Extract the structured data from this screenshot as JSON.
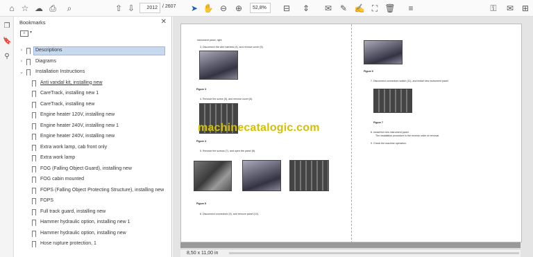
{
  "toolbar": {
    "page_current": "2012",
    "page_total": "2607",
    "zoom": "52,8%"
  },
  "sidebar": {
    "title": "Bookmarks",
    "items": [
      {
        "label": "Descriptions",
        "level": 0,
        "chevron": "right",
        "selected": true
      },
      {
        "label": "Diagrams",
        "level": 0,
        "chevron": "right"
      },
      {
        "label": "Installation Instructions",
        "level": 0,
        "chevron": "down"
      },
      {
        "label": "Anti vandal kit, installing new",
        "level": 1,
        "underline": true
      },
      {
        "label": "CareTrack, installing new 1",
        "level": 1
      },
      {
        "label": "CareTrack, installing new",
        "level": 1
      },
      {
        "label": "Engine heater 120V, installing new",
        "level": 1
      },
      {
        "label": "Engine heater 240V, installing new 1",
        "level": 1
      },
      {
        "label": "Engine heater 240V, installing new",
        "level": 1
      },
      {
        "label": "Extra work lamp, cab front only",
        "level": 1
      },
      {
        "label": "Extra work lamp",
        "level": 1
      },
      {
        "label": "FOG (Falling Object Guard), installing new",
        "level": 1
      },
      {
        "label": "FOG cabin mounted",
        "level": 1
      },
      {
        "label": "FOPS (Falling Object Protecting Structure), installing new",
        "level": 1
      },
      {
        "label": "FOPS",
        "level": 1
      },
      {
        "label": "Full track guard, installing new",
        "level": 1
      },
      {
        "label": "Hammer hydraulic option, installing new 1",
        "level": 1
      },
      {
        "label": "Hammer hydraulic option, installing new",
        "level": 1
      },
      {
        "label": "Hose rupture protection, 1",
        "level": 1
      }
    ]
  },
  "document": {
    "left": {
      "line0": "instrument panel, right",
      "step3": "3.   Disconnect the wire harness (4), and remove cover (5).",
      "fig3": "Figure 3",
      "step4": "4.   Remove the screw (5), and remove cover (6).",
      "fig4": "Figure 4",
      "step5": "5.   Remove the screws (7), and open the panel (8).",
      "fig5": "Figure 5",
      "step6": "6.   Disconnect connectors (9), and remove panel (10)."
    },
    "right": {
      "fig6": "Figure 6",
      "step7": "7.   Disconnect connectors switch (11), and install new instrument panel.",
      "fig7": "Figure 7",
      "step8": "8.   Install the new instrument panel.",
      "step8b": "The installation procedure is the reverse order of removal.",
      "step9": "9.   Check the machine operation."
    }
  },
  "watermark": "machinecatalogic.com",
  "status": {
    "page_size": "8,50 x 11,00 in"
  }
}
